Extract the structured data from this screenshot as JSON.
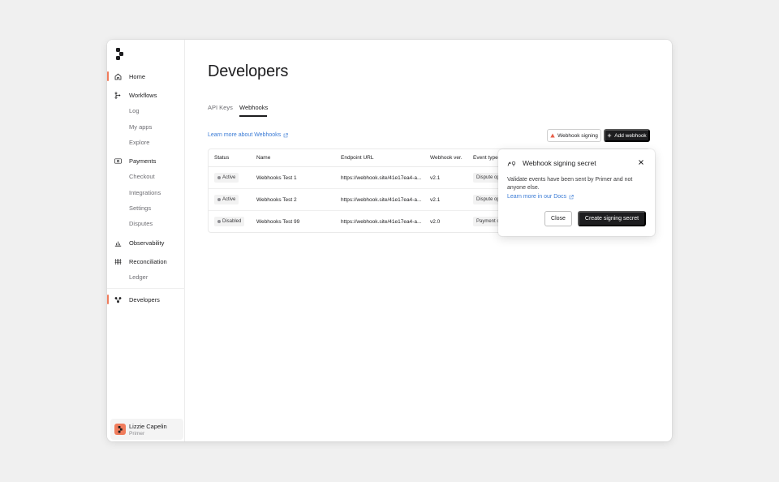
{
  "sidebar": {
    "items": [
      {
        "label": "Home",
        "icon": "home-icon",
        "level": "top",
        "active": true
      },
      {
        "label": "Workflows",
        "icon": "workflows-icon",
        "level": "top"
      },
      {
        "label": "Log",
        "level": "sub"
      },
      {
        "label": "My apps",
        "level": "sub"
      },
      {
        "label": "Explore",
        "level": "sub"
      },
      {
        "label": "Payments",
        "icon": "payments-icon",
        "level": "top"
      },
      {
        "label": "Checkout",
        "level": "sub"
      },
      {
        "label": "Integrations",
        "level": "sub"
      },
      {
        "label": "Settings",
        "level": "sub"
      },
      {
        "label": "Disputes",
        "level": "sub"
      },
      {
        "label": "Observability",
        "icon": "chart-icon",
        "level": "top"
      },
      {
        "label": "Reconciliation",
        "icon": "reconciliation-icon",
        "level": "top"
      },
      {
        "label": "Ledger",
        "level": "sub"
      },
      {
        "label": "Developers",
        "icon": "developers-icon",
        "level": "top",
        "active": true
      }
    ],
    "user": {
      "name": "Lizzie Capelin",
      "org": "Primer"
    }
  },
  "page": {
    "title": "Developers",
    "tabs": [
      "API Keys",
      "Webhooks"
    ],
    "learn_link": "Learn more about Webhooks",
    "signing_button": "Webhook signing",
    "add_button": "Add webhook"
  },
  "table": {
    "headers": [
      "Status",
      "Name",
      "Endpoint URL",
      "Webhook ver.",
      "Event types"
    ],
    "rows": [
      {
        "status": "Active",
        "name": "Webhooks Test 1",
        "url": "https://webhook.site/41e17ea4-a...",
        "version": "v2.1",
        "event": "Dispute op"
      },
      {
        "status": "Active",
        "name": "Webhooks Test 2",
        "url": "https://webhook.site/41e17ea4-a...",
        "version": "v2.1",
        "event": "Dispute op"
      },
      {
        "status": "Disabled",
        "name": "Webhooks Test 99",
        "url": "https://webhook.site/41e17ea4-a...",
        "version": "v2.0",
        "event": "Payment c"
      }
    ]
  },
  "popover": {
    "title": "Webhook signing secret",
    "body": "Validate events have been sent by Primer and not anyone else.",
    "link": "Learn more in our Docs",
    "close_label": "Close",
    "create_label": "Create signing secret"
  },
  "colors": {
    "accent": "#f07c5c",
    "link": "#3a7bd5",
    "dark": "#1d1d1f"
  }
}
